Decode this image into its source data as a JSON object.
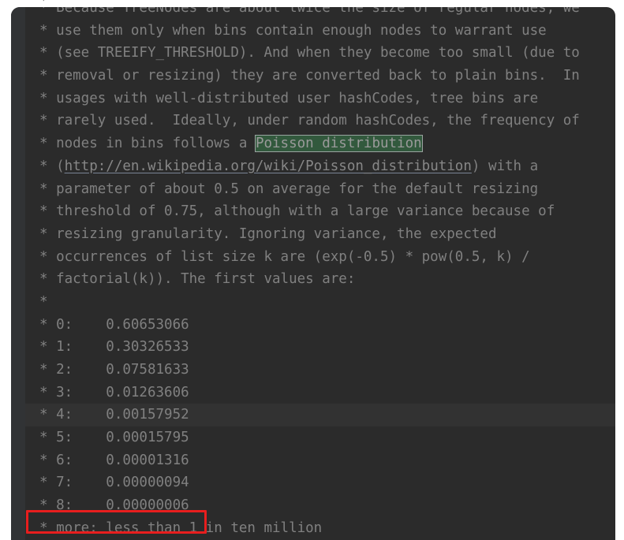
{
  "editor": {
    "theme_name": "darcula-dark",
    "colors": {
      "background": "#2b2b2b",
      "gutter": "#313335",
      "comment_text": "#808080",
      "current_line": "#323232",
      "search_highlight_bg": "#32593d",
      "search_highlight_border": "#9aa3a0",
      "link_text": "#878787",
      "annotation_red": "#e81e1e",
      "page_backdrop": "#ffffff"
    },
    "clipped_top_line": "*",
    "lines": [
      {
        "id": "line-because-treenodes",
        "segments": [
          {
            "type": "comment",
            "text": "* Because TreeNodes are about twice the size of regular nodes, we"
          }
        ]
      },
      {
        "id": "line-use-them-only",
        "segments": [
          {
            "type": "comment",
            "text": "* use them only when bins contain enough nodes to warrant use"
          }
        ]
      },
      {
        "id": "line-see-treeify-threshold",
        "segments": [
          {
            "type": "comment",
            "text": "* (see TREEIFY_THRESHOLD). And when they become too small (due to"
          }
        ]
      },
      {
        "id": "line-removal-or-resizing",
        "segments": [
          {
            "type": "comment",
            "text": "* removal or resizing) they are converted back to plain bins.  In"
          }
        ]
      },
      {
        "id": "line-usages-with-well-distributed",
        "segments": [
          {
            "type": "comment",
            "text": "* usages with well-distributed user hashCodes, tree bins are"
          }
        ]
      },
      {
        "id": "line-rarely-used",
        "segments": [
          {
            "type": "comment",
            "text": "* rarely used.  Ideally, under random hashCodes, the frequency of"
          }
        ]
      },
      {
        "id": "line-nodes-in-bins-follows",
        "segments": [
          {
            "type": "comment",
            "text": "* nodes in bins follows a "
          },
          {
            "type": "match",
            "text": "Poisson distribution"
          }
        ]
      },
      {
        "id": "line-wikipedia-url",
        "segments": [
          {
            "type": "comment",
            "text": "* ("
          },
          {
            "type": "link",
            "text": "http://en.wikipedia.org/wiki/Poisson_distribution"
          },
          {
            "type": "comment",
            "text": ") with a"
          }
        ]
      },
      {
        "id": "line-parameter-about",
        "segments": [
          {
            "type": "comment",
            "text": "* parameter of about 0.5 on average for the default resizing"
          }
        ]
      },
      {
        "id": "line-threshold-075",
        "segments": [
          {
            "type": "comment",
            "text": "* threshold of 0.75, although with a large variance because of"
          }
        ]
      },
      {
        "id": "line-resizing-granularity",
        "segments": [
          {
            "type": "comment",
            "text": "* resizing granularity. Ignoring variance, the expected"
          }
        ]
      },
      {
        "id": "line-occurrences-of-list-size",
        "segments": [
          {
            "type": "comment",
            "text": "* occurrences of list size k are (exp(-0.5) * pow(0.5, k) /"
          }
        ]
      },
      {
        "id": "line-factorial-k",
        "segments": [
          {
            "type": "comment",
            "text": "* factorial(k)). The first values are:"
          }
        ]
      },
      {
        "id": "line-blank-1",
        "segments": [
          {
            "type": "comment",
            "text": "*"
          }
        ]
      },
      {
        "id": "line-value-0",
        "segments": [
          {
            "type": "comment",
            "text": "* 0:    0.60653066"
          }
        ]
      },
      {
        "id": "line-value-1",
        "segments": [
          {
            "type": "comment",
            "text": "* 1:    0.30326533"
          }
        ]
      },
      {
        "id": "line-value-2",
        "segments": [
          {
            "type": "comment",
            "text": "* 2:    0.07581633"
          }
        ]
      },
      {
        "id": "line-value-3",
        "segments": [
          {
            "type": "comment",
            "text": "* 3:    0.01263606"
          }
        ]
      },
      {
        "id": "line-value-4",
        "current": true,
        "segments": [
          {
            "type": "comment",
            "text": "* 4:    0.00157952"
          }
        ]
      },
      {
        "id": "line-value-5",
        "segments": [
          {
            "type": "comment",
            "text": "* 5:    0.00015795"
          }
        ]
      },
      {
        "id": "line-value-6",
        "segments": [
          {
            "type": "comment",
            "text": "* 6:    0.00001316"
          }
        ]
      },
      {
        "id": "line-value-7",
        "segments": [
          {
            "type": "comment",
            "text": "* 7:    0.00000094"
          }
        ]
      },
      {
        "id": "line-value-8",
        "annotated": true,
        "segments": [
          {
            "type": "comment",
            "text": "* 8:    0.00000006"
          }
        ]
      },
      {
        "id": "line-value-9-clipped",
        "segments": [
          {
            "type": "comment",
            "text": "* more: less than 1 in ten million"
          }
        ]
      }
    ]
  },
  "poisson_table": {
    "description": "expected occurrences of list size k = (exp(-0.5) * pow(0.5, k) / factorial(k))",
    "keys": [
      "0",
      "1",
      "2",
      "3",
      "4",
      "5",
      "6",
      "7",
      "8"
    ],
    "values": [
      "0.60653066",
      "0.30326533",
      "0.07581633",
      "0.01263606",
      "0.00157952",
      "0.00015795",
      "0.00001316",
      "0.00000094",
      "0.00000006"
    ]
  },
  "annotation": {
    "name": "red-highlight-box",
    "target_line_id": "line-value-8",
    "target_text": "* 8:    0.00000006",
    "color": "#e81e1e"
  }
}
